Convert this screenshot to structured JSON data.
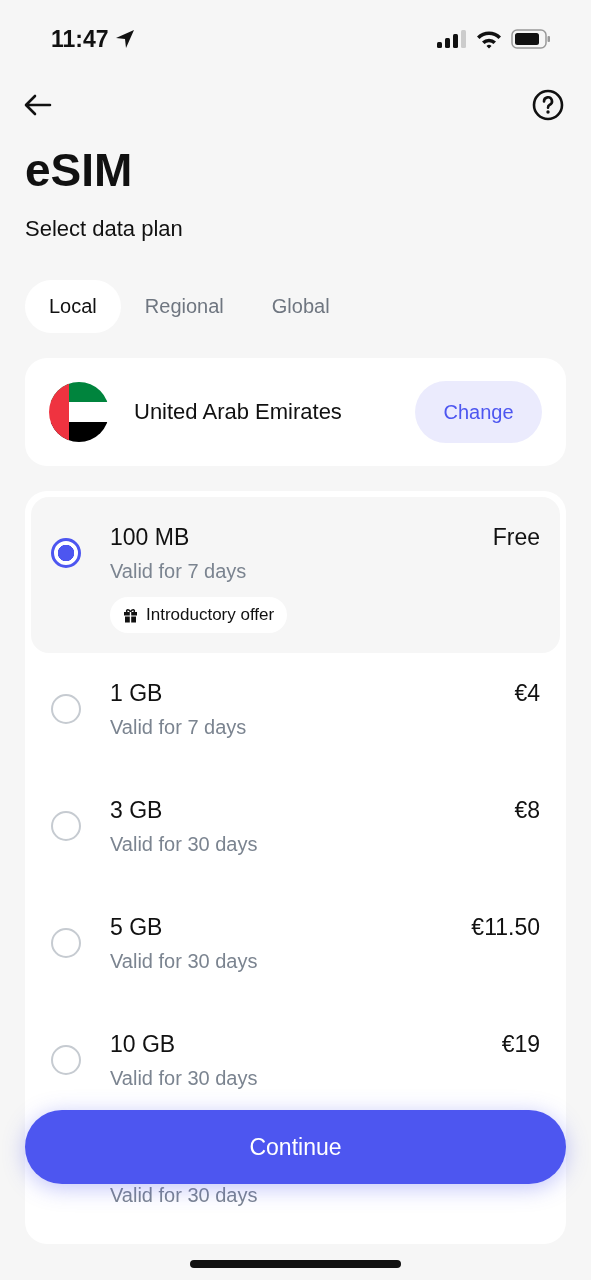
{
  "status_bar": {
    "time": "11:47"
  },
  "title": "eSIM",
  "subtitle": "Select data plan",
  "tabs": [
    {
      "label": "Local",
      "selected": true
    },
    {
      "label": "Regional",
      "selected": false
    },
    {
      "label": "Global",
      "selected": false
    }
  ],
  "country": {
    "name": "United Arab Emirates",
    "action": "Change"
  },
  "plans": [
    {
      "data": "100 MB",
      "validity": "Valid for 7 days",
      "price": "Free",
      "badge": "Introductory offer",
      "selected": true
    },
    {
      "data": "1 GB",
      "validity": "Valid for 7 days",
      "price": "€4",
      "selected": false
    },
    {
      "data": "3 GB",
      "validity": "Valid for 30 days",
      "price": "€8",
      "selected": false
    },
    {
      "data": "5 GB",
      "validity": "Valid for 30 days",
      "price": "€11.50",
      "selected": false
    },
    {
      "data": "10 GB",
      "validity": "Valid for 30 days",
      "price": "€19",
      "selected": false
    },
    {
      "validity": "Valid for 30 days"
    }
  ],
  "continue_button": "Continue"
}
